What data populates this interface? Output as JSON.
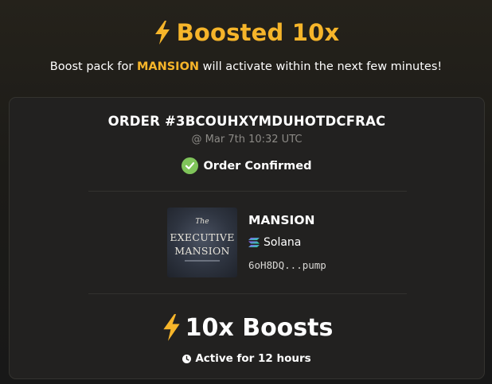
{
  "header": {
    "title": "Boosted 10x",
    "subtitle_prefix": "Boost pack for ",
    "subtitle_token": "MANSION",
    "subtitle_suffix": " will activate within the next few minutes!"
  },
  "order": {
    "id_label": "ORDER #3BCOUHXYMDUHOTDCFRAC",
    "timestamp": "@ Mar 7th 10:32 UTC",
    "status": "Order Confirmed"
  },
  "token": {
    "name": "MANSION",
    "chain": "Solana",
    "address": "6oH8DQ...pump",
    "image_text": {
      "line1": "The",
      "line2": "EXECUTIVE",
      "line3": "MANSION"
    }
  },
  "boost": {
    "label": "10x Boosts",
    "duration": "Active for 12 hours"
  },
  "colors": {
    "accent": "#f6b52a",
    "success": "#7fc45a",
    "solana_start": "#9945ff",
    "solana_end": "#14f195"
  },
  "icons": {
    "headline": "lightning-bolt-icon",
    "status": "check-circle-icon",
    "chain": "solana-logo-icon",
    "boost": "lightning-bolt-icon",
    "duration": "clock-icon"
  }
}
